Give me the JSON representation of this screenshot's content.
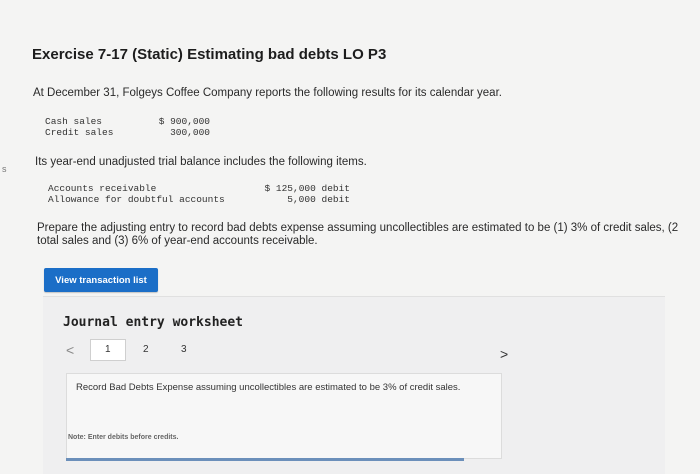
{
  "exercise": {
    "title": "Exercise 7-17 (Static) Estimating bad debts LO P3",
    "intro": "At December 31, Folgeys Coffee Company reports the following results for its calendar year.",
    "sales": [
      {
        "label": "Cash sales",
        "amount": "$ 900,000"
      },
      {
        "label": "Credit sales",
        "amount": "300,000"
      }
    ],
    "balance_intro": "Its year-end unadjusted trial balance includes the following items.",
    "balances": [
      {
        "label": "Accounts receivable",
        "amount": "$ 125,000 debit"
      },
      {
        "label": "Allowance for doubtful accounts",
        "amount": "5,000 debit"
      }
    ],
    "prompt_line1": "Prepare the adjusting entry to record bad debts expense assuming uncollectibles are estimated to be (1) 3% of credit sales, (2",
    "prompt_line2": "total sales and (3) 6% of year-end accounts receivable.",
    "side_mark": "s"
  },
  "toolbar": {
    "view_transactions_label": "View transaction list"
  },
  "worksheet": {
    "title": "Journal entry worksheet",
    "pages": [
      "1",
      "2",
      "3"
    ],
    "prev_icon": "<",
    "next_icon": ">",
    "instruction": "Record Bad Debts Expense assuming uncollectibles are estimated to be 3% of credit sales.",
    "note": "Note: Enter debits before credits."
  }
}
